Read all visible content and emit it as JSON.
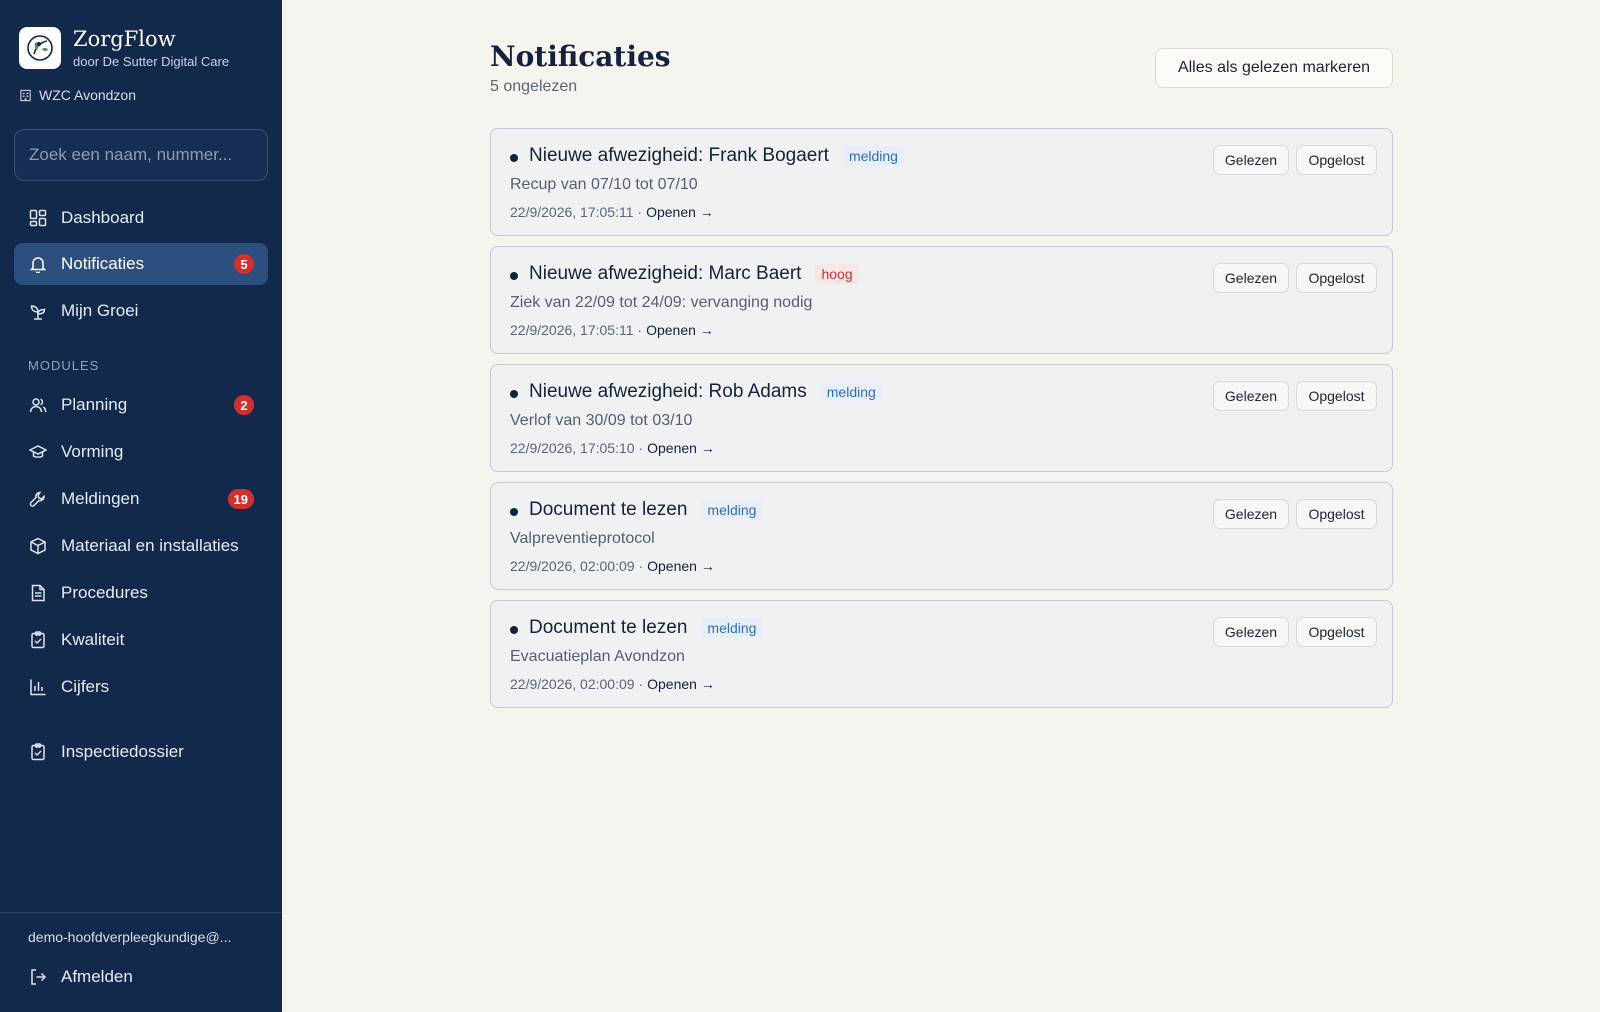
{
  "app": {
    "name": "ZorgFlow",
    "subtitle": "door De Sutter Digital Care",
    "organization": "WZC Avondzon"
  },
  "search": {
    "placeholder": "Zoek een naam, nummer..."
  },
  "nav": {
    "primary": [
      {
        "label": "Dashboard",
        "icon": "grid-icon"
      },
      {
        "label": "Notificaties",
        "icon": "bell-icon",
        "badge": "5",
        "active": true
      },
      {
        "label": "Mijn Groei",
        "icon": "sprout-icon"
      }
    ],
    "modules_label": "MODULES",
    "modules": [
      {
        "label": "Planning",
        "icon": "users-icon",
        "badge": "2"
      },
      {
        "label": "Vorming",
        "icon": "graduation-cap-icon"
      },
      {
        "label": "Meldingen",
        "icon": "wrench-icon",
        "badge": "19"
      },
      {
        "label": "Materiaal en installaties",
        "icon": "box-icon"
      },
      {
        "label": "Procedures",
        "icon": "document-icon"
      },
      {
        "label": "Kwaliteit",
        "icon": "clipboard-check-icon"
      },
      {
        "label": "Cijfers",
        "icon": "bar-chart-icon"
      }
    ],
    "extra": [
      {
        "label": "Inspectiedossier",
        "icon": "clipboard-check-icon"
      }
    ]
  },
  "user": {
    "email": "demo-hoofdverpleegkundige@...",
    "logout_label": "Afmelden"
  },
  "page": {
    "title": "Notificaties",
    "unread": "5 ongelezen",
    "mark_all_label": "Alles als gelezen markeren"
  },
  "notifications": [
    {
      "title": "Nieuwe afwezigheid: Frank Bogaert",
      "tag": "melding",
      "tag_type": "melding",
      "description": "Recup van 07/10 tot 07/10",
      "timestamp": "22/9/2026, 17:05:11 ·",
      "open_label": "Openen →",
      "read_label": "Gelezen",
      "solved_label": "Opgelost"
    },
    {
      "title": "Nieuwe afwezigheid: Marc Baert",
      "tag": "hoog",
      "tag_type": "hoog",
      "description": "Ziek van 22/09 tot 24/09: vervanging nodig",
      "timestamp": "22/9/2026, 17:05:11 ·",
      "open_label": "Openen →",
      "read_label": "Gelezen",
      "solved_label": "Opgelost"
    },
    {
      "title": "Nieuwe afwezigheid: Rob Adams",
      "tag": "melding",
      "tag_type": "melding",
      "description": "Verlof van 30/09 tot 03/10",
      "timestamp": "22/9/2026, 17:05:10 ·",
      "open_label": "Openen →",
      "read_label": "Gelezen",
      "solved_label": "Opgelost"
    },
    {
      "title": "Document te lezen",
      "tag": "melding",
      "tag_type": "melding",
      "description": "Valpreventieprotocol",
      "timestamp": "22/9/2026, 02:00:09 ·",
      "open_label": "Openen →",
      "read_label": "Gelezen",
      "solved_label": "Opgelost"
    },
    {
      "title": "Document te lezen",
      "tag": "melding",
      "tag_type": "melding",
      "description": "Evacuatieplan Avondzon",
      "timestamp": "22/9/2026, 02:00:09 ·",
      "open_label": "Openen →",
      "read_label": "Gelezen",
      "solved_label": "Opgelost"
    }
  ],
  "colors": {
    "sidebar_bg": "#13294b",
    "active_item_bg": "#2d4f7f",
    "badge_red": "#d0312d",
    "page_bg": "#f6f4ef",
    "tag_melding": "#2f6fb5",
    "tag_hoog": "#c2362f"
  }
}
